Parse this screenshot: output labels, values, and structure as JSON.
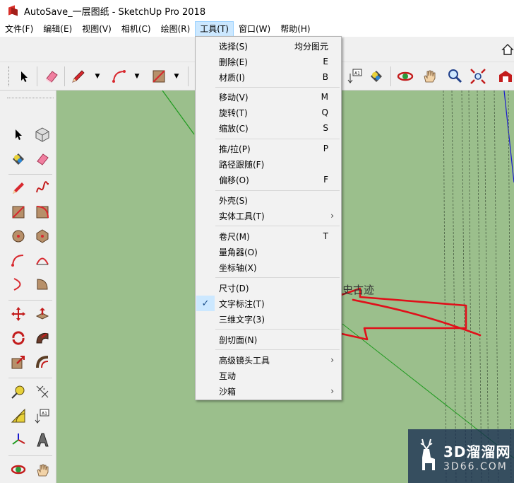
{
  "window": {
    "title": "AutoSave_一层图纸 - SketchUp Pro 2018"
  },
  "menubar": [
    {
      "label": "文件(F)"
    },
    {
      "label": "编辑(E)"
    },
    {
      "label": "视图(V)"
    },
    {
      "label": "相机(C)"
    },
    {
      "label": "绘图(R)"
    },
    {
      "label": "工具(T)",
      "active": true
    },
    {
      "label": "窗口(W)"
    },
    {
      "label": "帮助(H)"
    }
  ],
  "tools_menu": {
    "items": [
      {
        "label": "选择(S)",
        "shortcut": "均分图元"
      },
      {
        "label": "删除(E)",
        "shortcut": "E"
      },
      {
        "label": "材质(I)",
        "shortcut": "B"
      },
      {
        "label": "移动(V)",
        "shortcut": "M"
      },
      {
        "label": "旋转(T)",
        "shortcut": "Q"
      },
      {
        "label": "缩放(C)",
        "shortcut": "S"
      },
      {
        "label": "推/拉(P)",
        "shortcut": "P"
      },
      {
        "label": "路径跟随(F)",
        "shortcut": ""
      },
      {
        "label": "偏移(O)",
        "shortcut": "F"
      },
      {
        "label": "外壳(S)",
        "shortcut": ""
      },
      {
        "label": "实体工具(T)",
        "submenu_arrow": "›"
      },
      {
        "label": "卷尺(M)",
        "shortcut": "T"
      },
      {
        "label": "量角器(O)",
        "shortcut": ""
      },
      {
        "label": "坐标轴(X)",
        "shortcut": ""
      },
      {
        "label": "尺寸(D)",
        "shortcut": ""
      },
      {
        "label": "文字标注(T)",
        "shortcut": "",
        "checked": true,
        "check_glyph": "✓"
      },
      {
        "label": "三维文字(3)",
        "shortcut": ""
      },
      {
        "label": "剖切面(N)",
        "shortcut": ""
      },
      {
        "label": "高级镜头工具",
        "submenu_arrow": "›"
      },
      {
        "label": "互动",
        "shortcut": ""
      },
      {
        "label": "沙箱",
        "submenu_arrow": "›"
      }
    ]
  },
  "scene": {
    "text": "史古迹"
  },
  "watermark": {
    "line1": "3D溜溜网",
    "line2": "3D66.COM"
  },
  "colors": {
    "viewport_bg": "#9bbf8c",
    "annotation_red": "#e0101a",
    "menu_highlight": "#cce8ff",
    "axis_green": "#1f9a1f",
    "axis_blue": "#1a1ad0"
  },
  "icons": {
    "select": "arrow-cursor-icon",
    "eraser": "eraser-icon",
    "pencil": "pencil-icon",
    "arc": "arc-icon",
    "rectangle": "rectangle-icon"
  }
}
